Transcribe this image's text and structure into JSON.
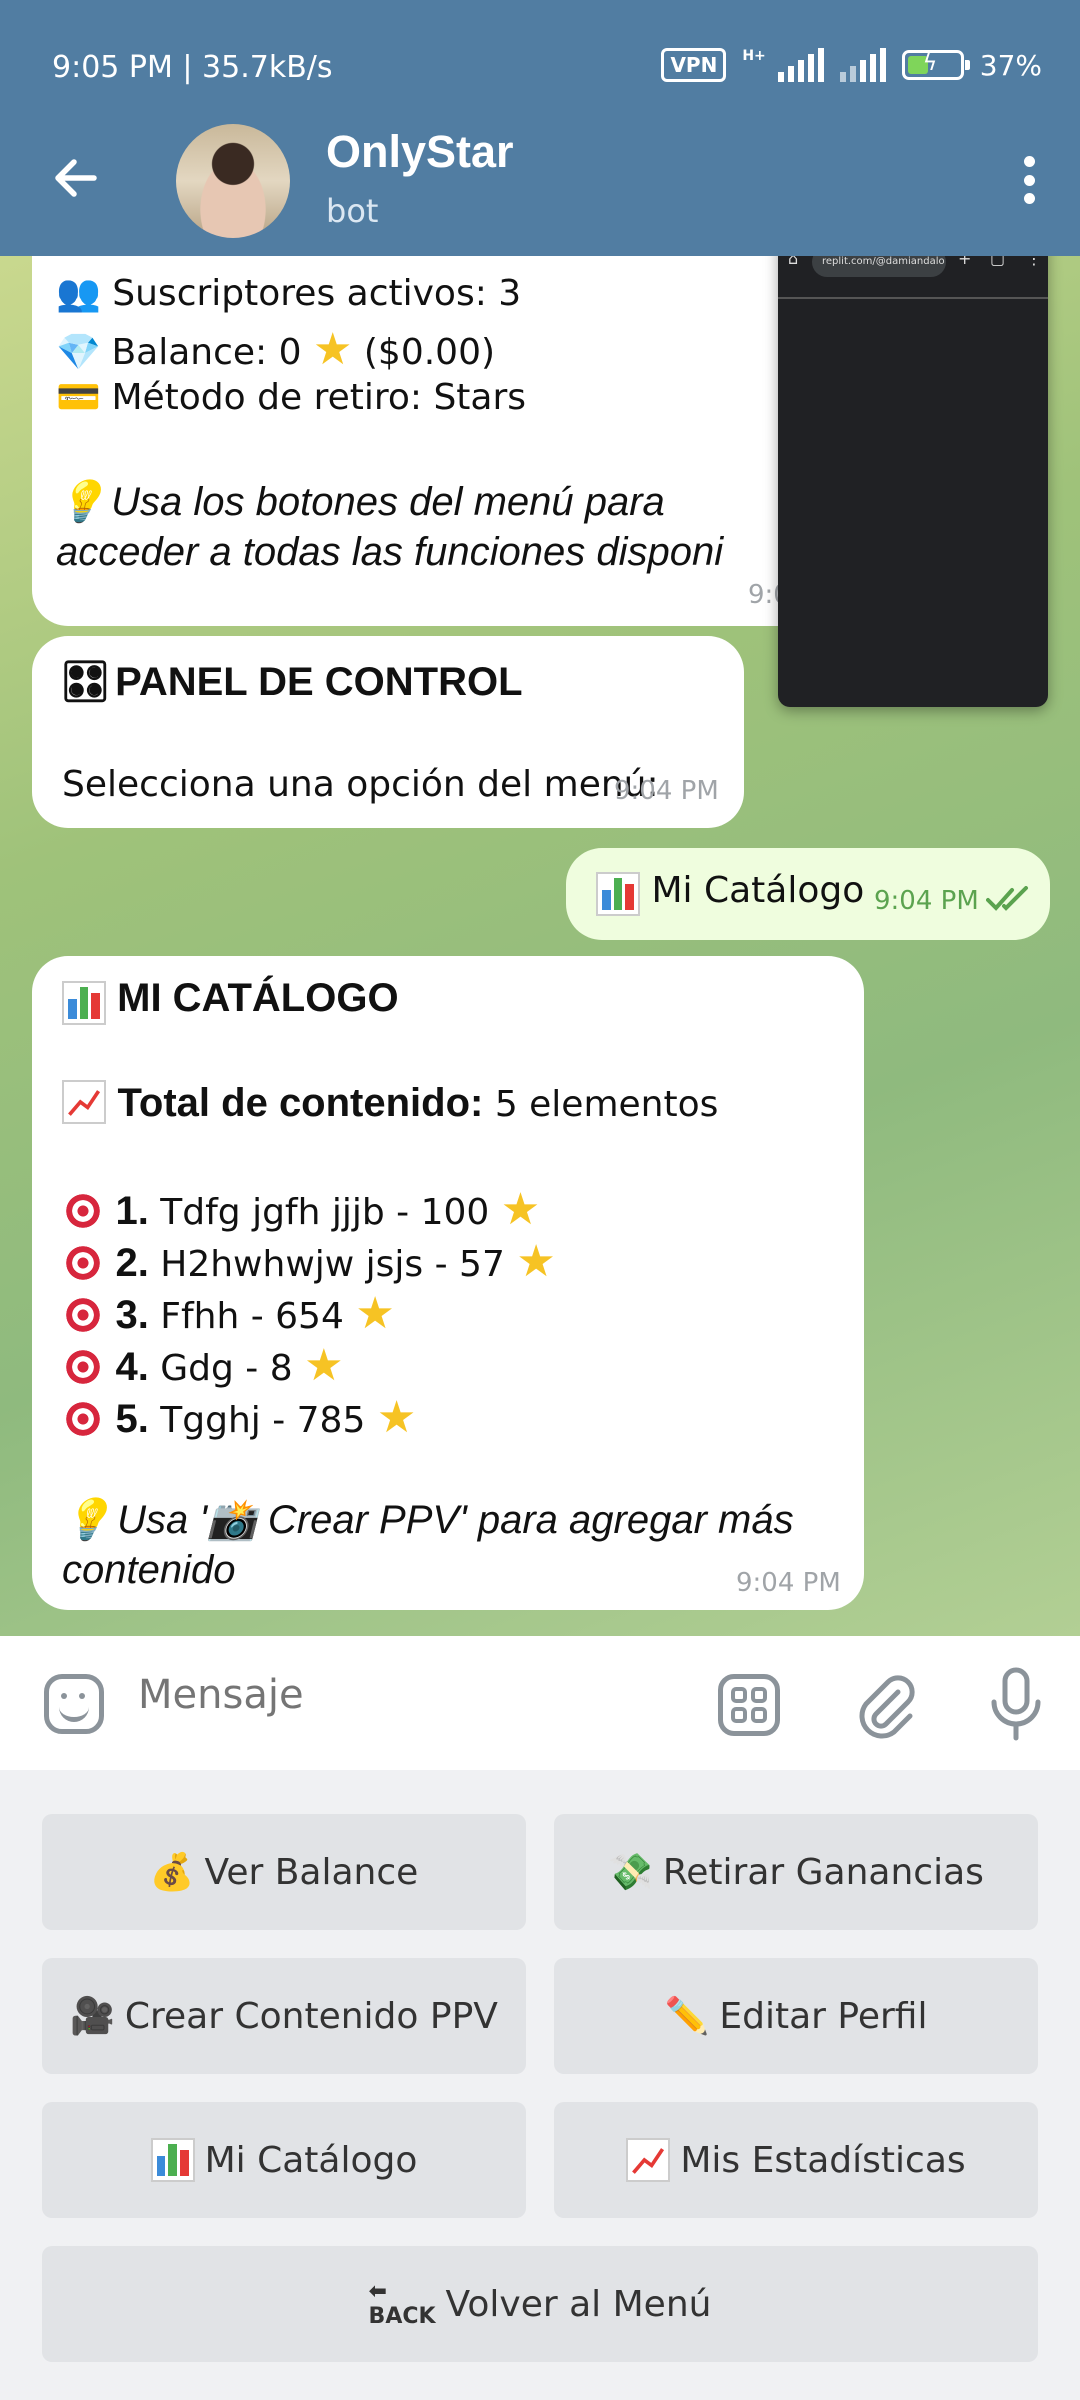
{
  "status_bar": {
    "time": "9:05 PM | 35.7kB/s",
    "vpn": "VPN",
    "network": "H+",
    "battery": "37%"
  },
  "header": {
    "title": "OnlyStar",
    "subtitle": "bot"
  },
  "pip": {
    "url": "replit.com/@damiandalo"
  },
  "messages": {
    "m1": {
      "line1": "👥 Suscriptores activos: 3",
      "line2_a": "Balance: 0",
      "line2_b": "($0.00)",
      "line3": "Método de retiro: Stars",
      "tip1": "Usa los botones del menú para",
      "tip2": "acceder a todas las funciones disponi",
      "time": "9:0"
    },
    "m2": {
      "title": "PANEL DE CONTROL",
      "text": "Selecciona una opción del menú:",
      "time": "9:04 PM"
    },
    "m3": {
      "text": "Mi Catálogo",
      "time": "9:04 PM"
    },
    "m4": {
      "title": "MI CATÁLOGO",
      "total_label": "Total de contenido:",
      "total_value": "5 elementos",
      "items": [
        {
          "num": "1.",
          "text": "Tdfg jgfh jjjb - 100"
        },
        {
          "num": "2.",
          "text": "H2hwhwjw jsjs - 57"
        },
        {
          "num": "3.",
          "text": "Ffhh - 654"
        },
        {
          "num": "4.",
          "text": "Gdg - 8"
        },
        {
          "num": "5.",
          "text": "Tgghj - 785"
        }
      ],
      "tip1": "Usa '📸 Crear PPV' para agregar más",
      "tip2": "contenido",
      "time": "9:04 PM"
    }
  },
  "input": {
    "placeholder": "Mensaje"
  },
  "keyboard": {
    "ver_balance": "Ver Balance",
    "retirar": "Retirar Ganancias",
    "crear_ppv": "Crear Contenido PPV",
    "editar_perfil": "Editar Perfil",
    "mi_catalogo": "Mi Catálogo",
    "estadisticas": "Mis Estadísticas",
    "volver": "Volver al Menú"
  }
}
